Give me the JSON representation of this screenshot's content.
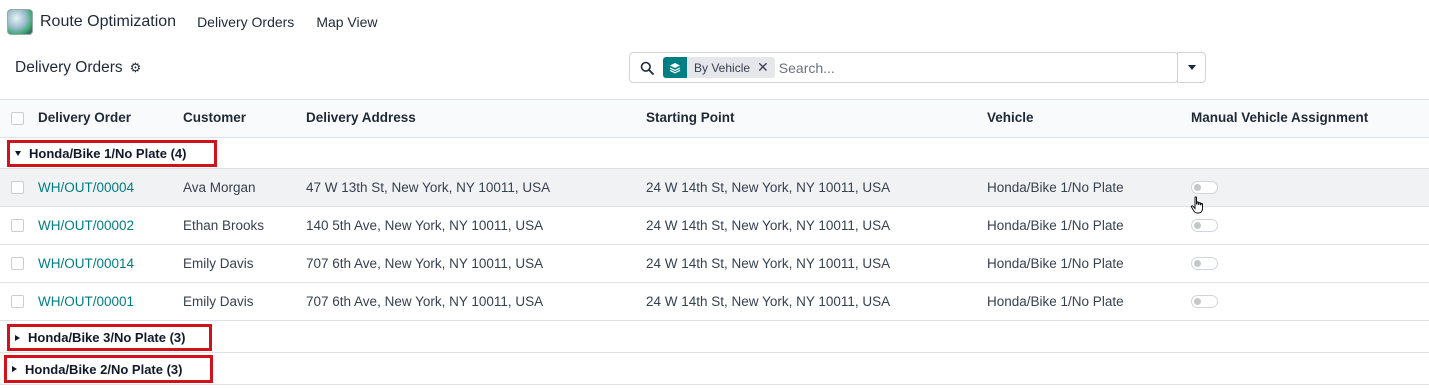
{
  "navbar": {
    "app_name": "Route Optimization",
    "menu": [
      "Delivery Orders",
      "Map View"
    ]
  },
  "control_panel": {
    "title": "Delivery Orders",
    "settings_icon": "gear-icon",
    "search": {
      "facet_icon": "layers-icon",
      "facet_value": "By Vehicle",
      "facet_remove_icon": "close-icon",
      "placeholder": "Search..."
    }
  },
  "table": {
    "headers": [
      "Delivery Order",
      "Customer",
      "Delivery Address",
      "Starting Point",
      "Vehicle",
      "Manual Vehicle Assignment"
    ],
    "groups": [
      {
        "label": "Honda/Bike 1/No Plate (4)",
        "expanded": true,
        "rows": [
          {
            "order": "WH/OUT/00004",
            "customer": "Ava Morgan",
            "address": "47 W 13th St, New York, NY 10011, USA",
            "start": "24 W 14th St, New York, NY 10011, USA",
            "vehicle": "Honda/Bike 1/No Plate",
            "manual": false
          },
          {
            "order": "WH/OUT/00002",
            "customer": "Ethan Brooks",
            "address": "140 5th Ave, New York, NY 10011, USA",
            "start": "24 W 14th St, New York, NY 10011, USA",
            "vehicle": "Honda/Bike 1/No Plate",
            "manual": false
          },
          {
            "order": "WH/OUT/00014",
            "customer": "Emily Davis",
            "address": "707 6th Ave, New York, NY 10011, USA",
            "start": "24 W 14th St, New York, NY 10011, USA",
            "vehicle": "Honda/Bike 1/No Plate",
            "manual": false
          },
          {
            "order": "WH/OUT/00001",
            "customer": "Emily Davis",
            "address": "707 6th Ave, New York, NY 10011, USA",
            "start": "24 W 14th St, New York, NY 10011, USA",
            "vehicle": "Honda/Bike 1/No Plate",
            "manual": false
          }
        ]
      },
      {
        "label": "Honda/Bike 3/No Plate (3)",
        "expanded": false
      },
      {
        "label": "Honda/Bike 2/No Plate (3)",
        "expanded": false
      }
    ]
  },
  "colors": {
    "accent": "#017e84",
    "highlight_box": "#d0121c"
  }
}
